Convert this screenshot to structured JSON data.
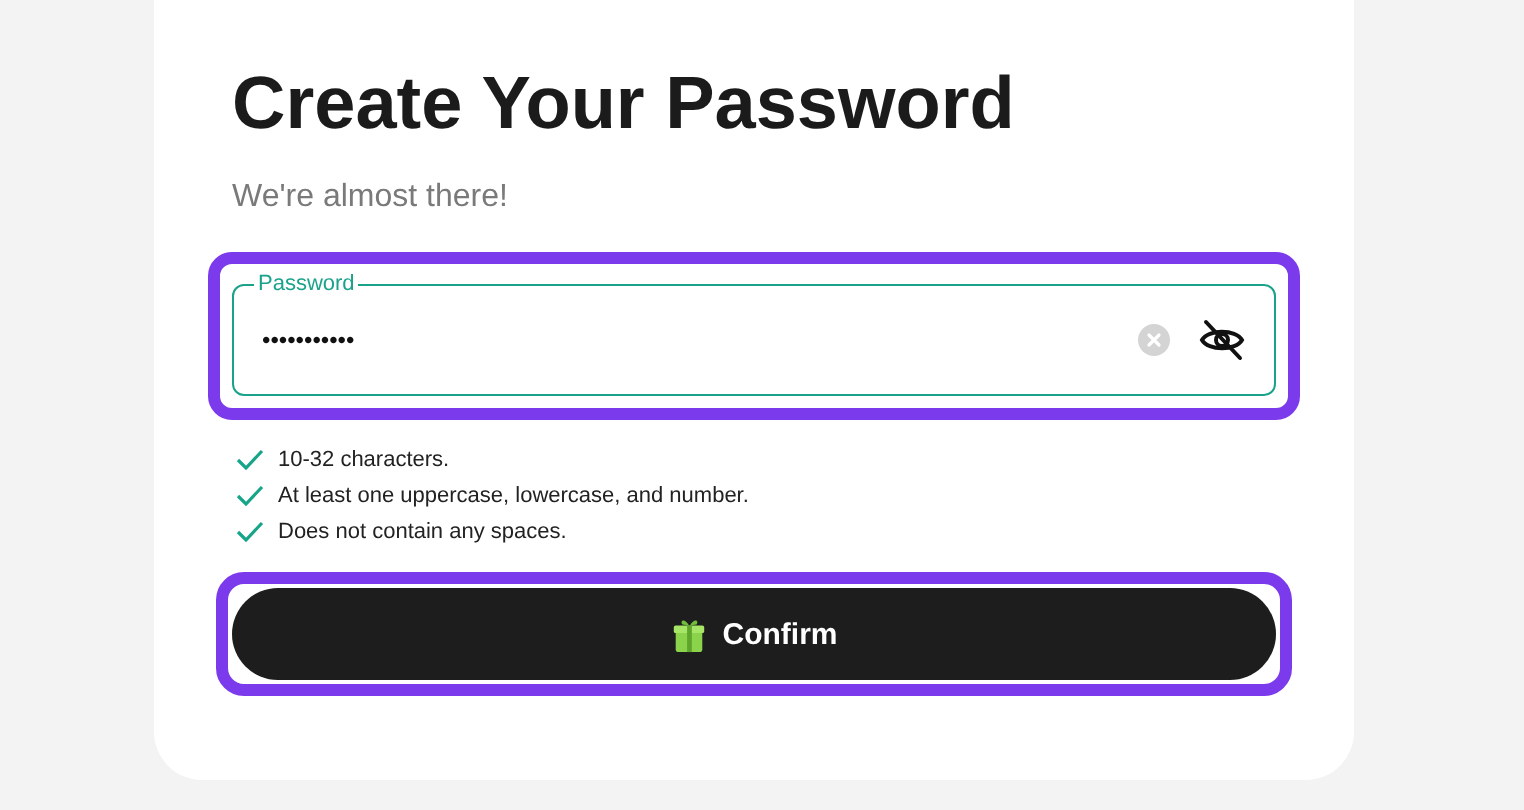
{
  "title": "Create Your Password",
  "subtitle": "We're almost there!",
  "password": {
    "label": "Password",
    "value": "•••••••••••"
  },
  "requirements": [
    {
      "text": "10-32 characters.",
      "met": true
    },
    {
      "text": "At least one uppercase, lowercase, and number.",
      "met": true
    },
    {
      "text": "Does not contain any spaces.",
      "met": true
    }
  ],
  "confirm_button": {
    "label": "Confirm"
  }
}
